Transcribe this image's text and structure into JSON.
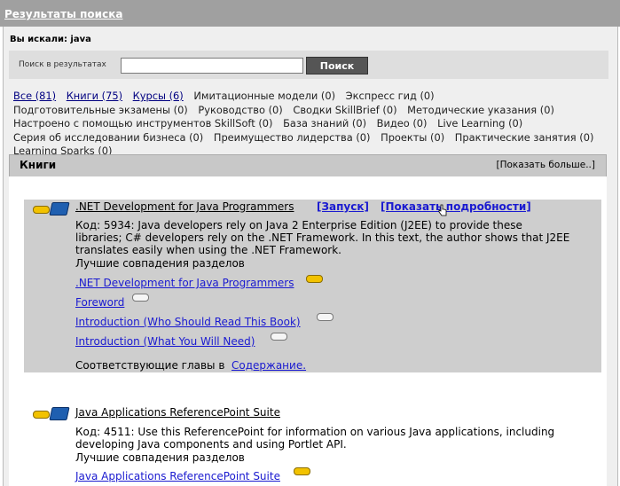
{
  "header": {
    "title": "Результаты поиска"
  },
  "search": {
    "searched_label": "Вы искали: java",
    "field_label": "Поиск в результатах",
    "field_value": "",
    "button_label": "Поиск"
  },
  "categories": [
    {
      "label": "Все (81)",
      "link": true
    },
    {
      "label": "Книги (75)",
      "link": true
    },
    {
      "label": "Курсы (6)",
      "link": true
    },
    {
      "label": "Имитационные модели (0)",
      "link": false
    },
    {
      "label": "Экспресс гид (0)",
      "link": false
    },
    {
      "label": "Подготовительные экзамены (0)",
      "link": false
    },
    {
      "label": "Руководство (0)",
      "link": false
    },
    {
      "label": "Сводки SkillBrief (0)",
      "link": false
    },
    {
      "label": "Методические указания (0)",
      "link": false
    },
    {
      "label": "Настроено с помощью инструментов SkillSoft (0)",
      "link": false
    },
    {
      "label": "База знаний (0)",
      "link": false
    },
    {
      "label": "Видео (0)",
      "link": false
    },
    {
      "label": "Live Learning (0)",
      "link": false
    },
    {
      "label": "Серия об исследовании бизнеса (0)",
      "link": false
    },
    {
      "label": "Преимущество лидерства (0)",
      "link": false
    },
    {
      "label": "Проекты (0)",
      "link": false
    },
    {
      "label": "Практические занятия (0)",
      "link": false
    },
    {
      "label": "Learning Sparks (0)",
      "link": false
    }
  ],
  "section": {
    "title": "Книги",
    "more_label": "[Показать больше..]"
  },
  "results": [
    {
      "title": ".NET Development for Java Programmers",
      "launch_label": "[Запуск]",
      "details_label": "[Показать подробности]",
      "desc_line1": "Код: 5934: Java developers rely on Java 2 Enterprise Edition (J2EE) to provide these",
      "desc_line2": "libraries; C# developers rely on the .NET Framework. In this text, the author shows that J2EE",
      "desc_line3": "translates easily when using the .NET Framework.",
      "best_matches_label": "Лучшие совпадения разделов",
      "sections": [
        ".NET Development for Java Programmers",
        "Foreword",
        "Introduction (Who Should Read This Book)",
        "Introduction (What You Will Need)"
      ],
      "chapters_text": "Соответствующие главы в",
      "chapters_link": "Содержание."
    },
    {
      "title": "Java Applications ReferencePoint Suite",
      "desc_line1": "Код: 4511: Use this ReferencePoint for information on various Java applications, including",
      "desc_line2": "developing Java components and using Portlet API.",
      "best_matches_label": "Лучшие совпадения разделов",
      "sections": [
        "Java Applications ReferencePoint Suite"
      ]
    }
  ]
}
